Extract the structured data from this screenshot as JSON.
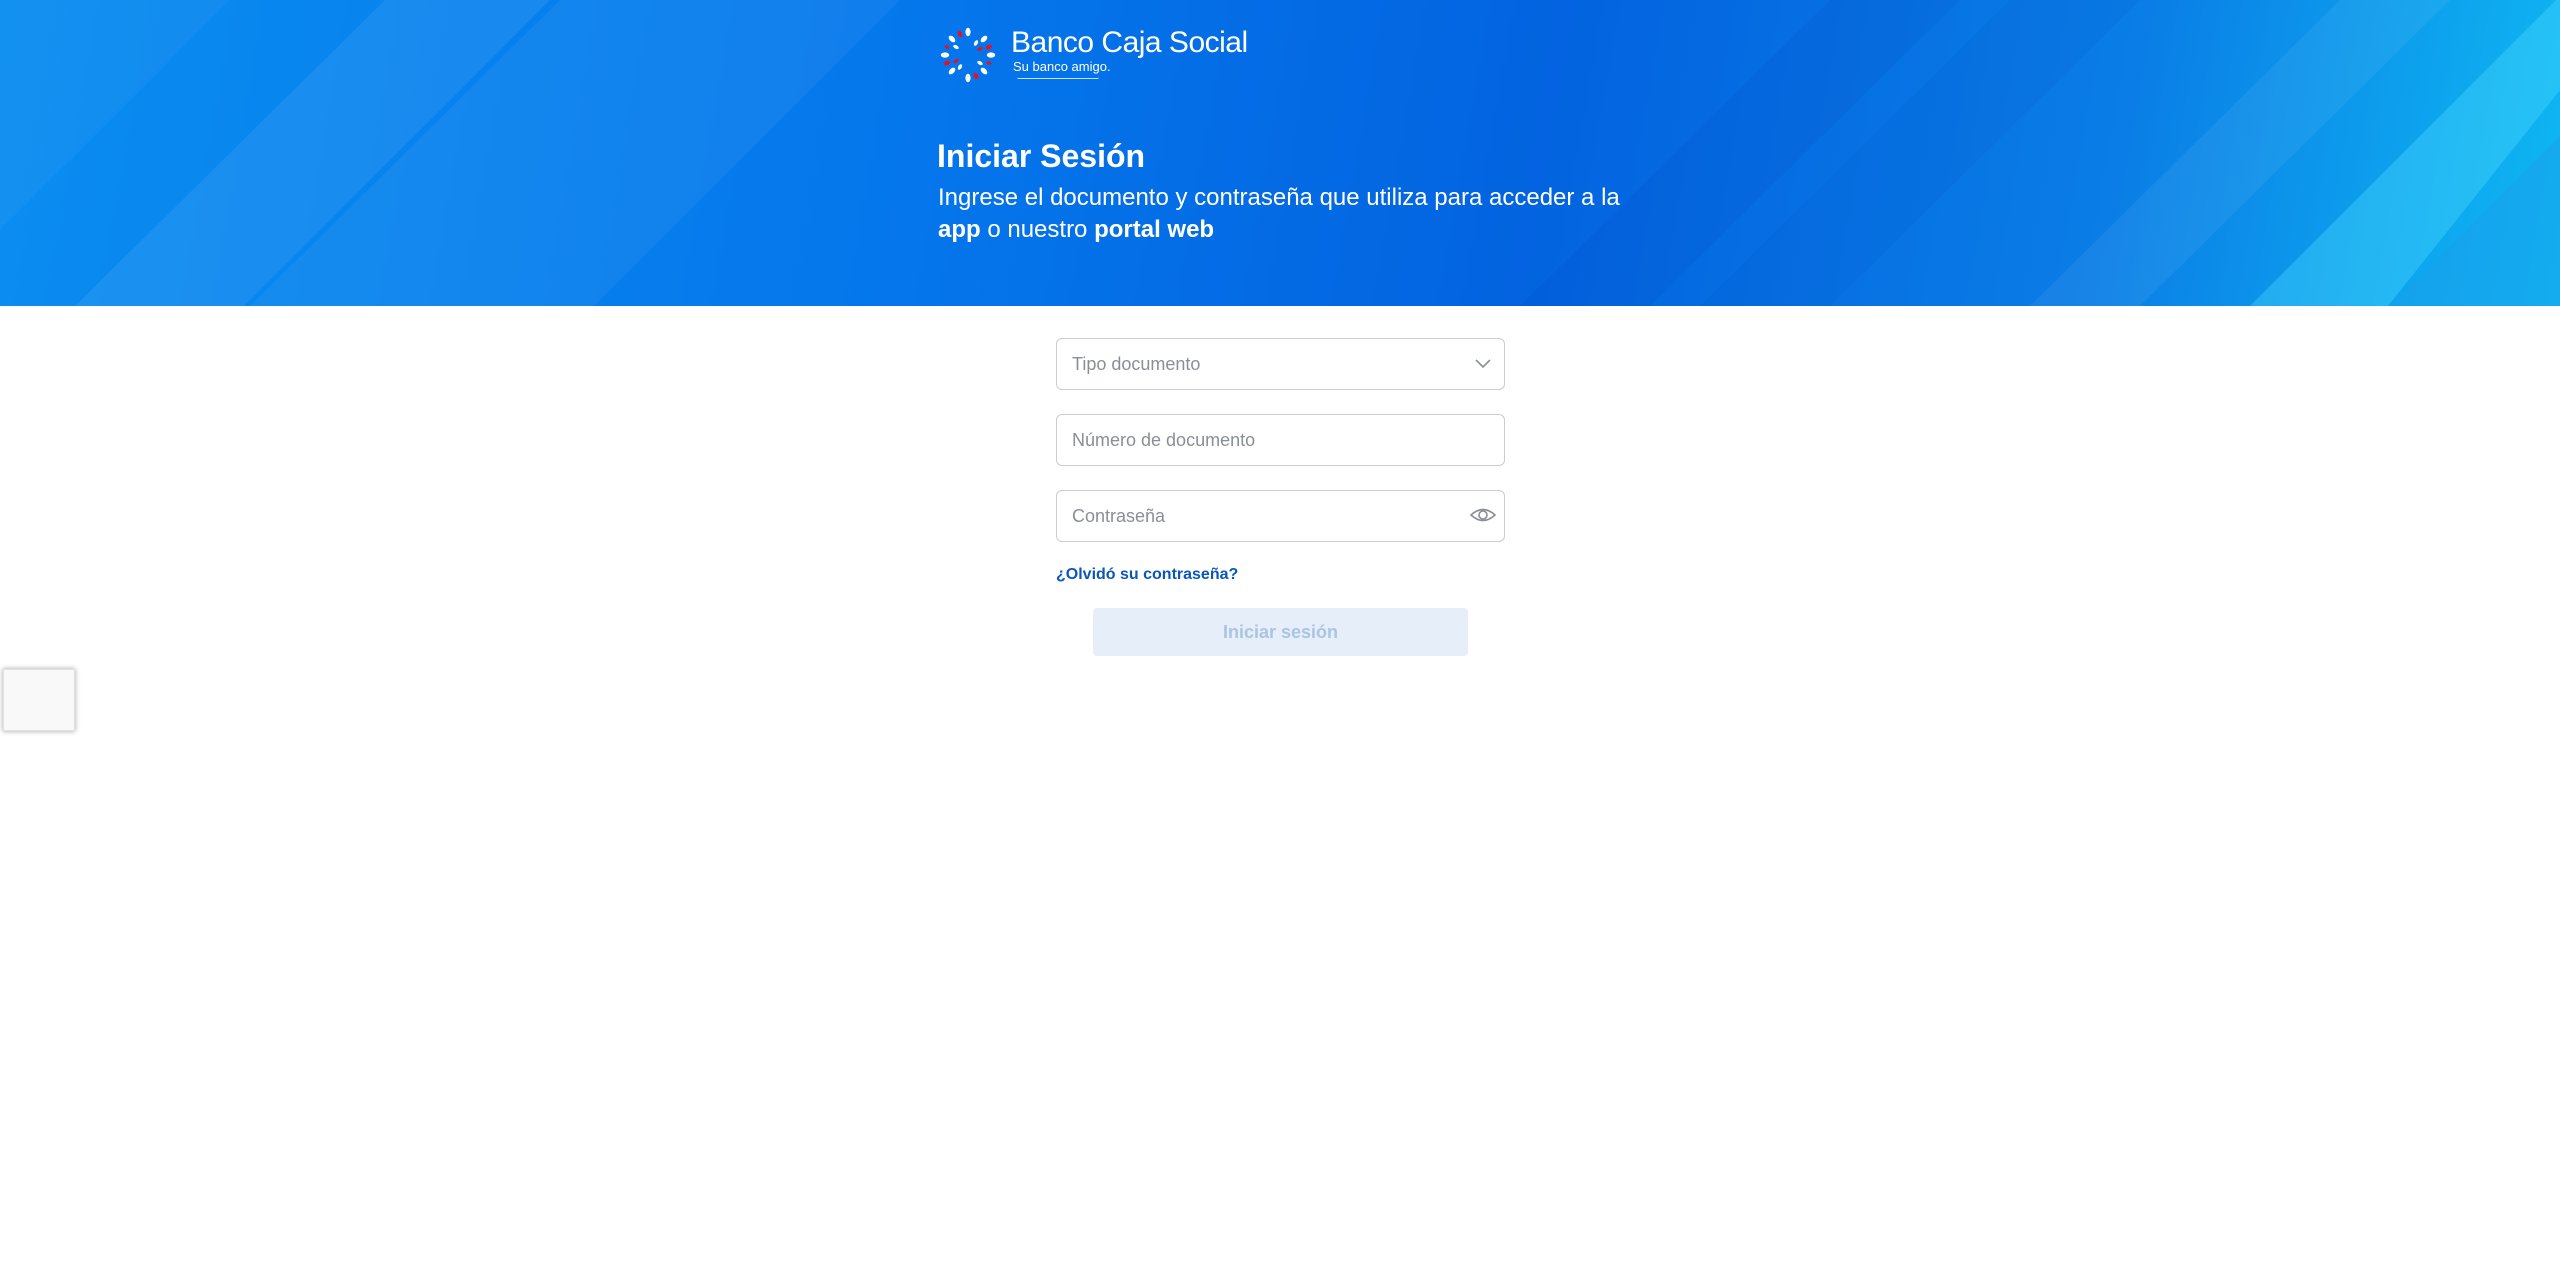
{
  "brand": {
    "name": "Banco Caja Social",
    "slogan": "Su banco amigo."
  },
  "hero": {
    "title": "Iniciar Sesión",
    "description_prefix": "Ingrese el documento y contraseña que utiliza para acceder a la ",
    "app_text": "app",
    "middle_text": " o nuestro ",
    "portal_text": "portal web"
  },
  "form": {
    "doc_type_placeholder": "Tipo documento",
    "doc_number_placeholder": "Número de documento",
    "password_placeholder": "Contraseña",
    "forgot_link": "¿Olvidó su contraseña?",
    "submit_label": "Iniciar sesión"
  },
  "icons": {
    "chevron": "chevron-down-icon",
    "eye": "eye-icon",
    "logo": "logo-icon"
  },
  "colors": {
    "hero_blue": "#0577ec",
    "link_blue": "#0a57b8",
    "button_disabled_bg": "#e6eff9",
    "button_disabled_text": "#aac5e2",
    "logo_red": "#e3122b"
  }
}
